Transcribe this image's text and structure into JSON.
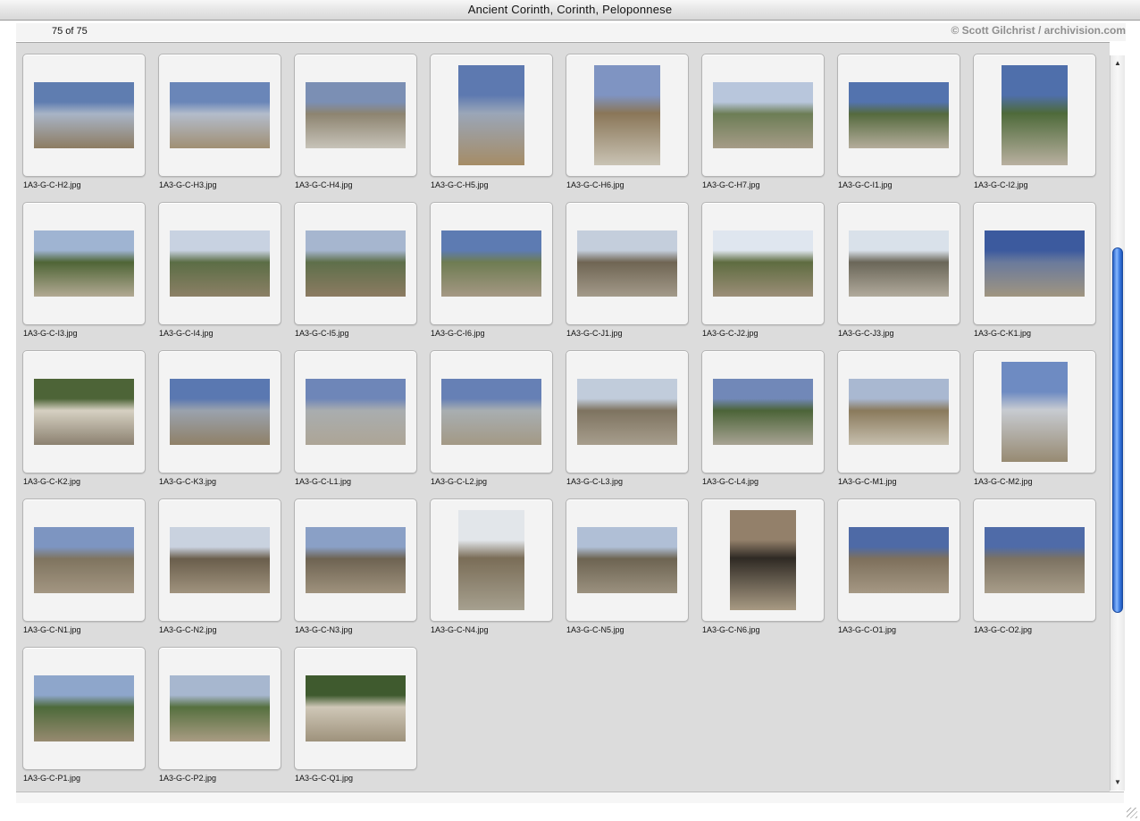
{
  "window": {
    "title": "Ancient Corinth, Corinth, Peloponnese"
  },
  "header": {
    "count": "75 of 75",
    "credit": "© Scott Gilchrist / archivision.com"
  },
  "scroll": {
    "position": 0.52,
    "visible_fraction": 0.52
  },
  "thumbnails": [
    {
      "name": "1A3-G-C-H2.jpg",
      "orientation": "land",
      "colors": [
        "#5f7db0",
        "#a8b4c6",
        "#8d7c62"
      ]
    },
    {
      "name": "1A3-G-C-H3.jpg",
      "orientation": "land",
      "colors": [
        "#6a86b8",
        "#b3bccb",
        "#a08f73"
      ]
    },
    {
      "name": "1A3-G-C-H4.jpg",
      "orientation": "land",
      "colors": [
        "#7b8fb4",
        "#8d8470",
        "#c7c3b9"
      ]
    },
    {
      "name": "1A3-G-C-H5.jpg",
      "orientation": "port",
      "colors": [
        "#5d79b0",
        "#9aa6b8",
        "#a58c66"
      ]
    },
    {
      "name": "1A3-G-C-H6.jpg",
      "orientation": "port",
      "colors": [
        "#7f94c2",
        "#8a7658",
        "#c9c3b4"
      ]
    },
    {
      "name": "1A3-G-C-H7.jpg",
      "orientation": "land",
      "colors": [
        "#b8c6dc",
        "#6c7d55",
        "#a69c88"
      ]
    },
    {
      "name": "1A3-G-C-I1.jpg",
      "orientation": "land",
      "colors": [
        "#5373ae",
        "#556a3e",
        "#b5ad9c"
      ]
    },
    {
      "name": "1A3-G-C-I2.jpg",
      "orientation": "port",
      "colors": [
        "#4f6fab",
        "#4e6a3a",
        "#b9b0a0"
      ]
    },
    {
      "name": "1A3-G-C-I3.jpg",
      "orientation": "land",
      "colors": [
        "#9fb4d2",
        "#4f6536",
        "#b2a993"
      ]
    },
    {
      "name": "1A3-G-C-I4.jpg",
      "orientation": "land",
      "colors": [
        "#c8d2e1",
        "#5b6d45",
        "#8c8066"
      ]
    },
    {
      "name": "1A3-G-C-I5.jpg",
      "orientation": "land",
      "colors": [
        "#a6b6cf",
        "#5e6f4a",
        "#8c7b62"
      ]
    },
    {
      "name": "1A3-G-C-I6.jpg",
      "orientation": "land",
      "colors": [
        "#5d7bb2",
        "#6e7c52",
        "#a59884"
      ]
    },
    {
      "name": "1A3-G-C-J1.jpg",
      "orientation": "land",
      "colors": [
        "#c4cedc",
        "#6f6553",
        "#a39a8a"
      ]
    },
    {
      "name": "1A3-G-C-J2.jpg",
      "orientation": "land",
      "colors": [
        "#dfe6ef",
        "#5e6c40",
        "#9c8e78"
      ]
    },
    {
      "name": "1A3-G-C-J3.jpg",
      "orientation": "land",
      "colors": [
        "#d9e1ea",
        "#6a6658",
        "#b1aa9c"
      ]
    },
    {
      "name": "1A3-G-C-K1.jpg",
      "orientation": "land",
      "colors": [
        "#3c5a9e",
        "#6a7a9c",
        "#a09580"
      ]
    },
    {
      "name": "1A3-G-C-K2.jpg",
      "orientation": "land",
      "colors": [
        "#4d6437",
        "#d6d0c2",
        "#8b8170"
      ]
    },
    {
      "name": "1A3-G-C-K3.jpg",
      "orientation": "land",
      "colors": [
        "#5a78b1",
        "#9aa2ad",
        "#8f8067"
      ]
    },
    {
      "name": "1A3-G-C-L1.jpg",
      "orientation": "land",
      "colors": [
        "#6e86b8",
        "#a9adaf",
        "#ada596"
      ]
    },
    {
      "name": "1A3-G-C-L2.jpg",
      "orientation": "land",
      "colors": [
        "#6680b5",
        "#a8aeb1",
        "#a39985"
      ]
    },
    {
      "name": "1A3-G-C-L3.jpg",
      "orientation": "land",
      "colors": [
        "#c1ccdb",
        "#7e7360",
        "#a79e8d"
      ]
    },
    {
      "name": "1A3-G-C-L4.jpg",
      "orientation": "land",
      "colors": [
        "#7188b8",
        "#4c6438",
        "#a8a394"
      ]
    },
    {
      "name": "1A3-G-C-M1.jpg",
      "orientation": "land",
      "colors": [
        "#a9b8d1",
        "#8a7a5c",
        "#c6bfae"
      ]
    },
    {
      "name": "1A3-G-C-M2.jpg",
      "orientation": "port",
      "colors": [
        "#6e8bc2",
        "#c7cbd1",
        "#978a72"
      ]
    },
    {
      "name": "1A3-G-C-N1.jpg",
      "orientation": "land",
      "colors": [
        "#7d95c1",
        "#7f745f",
        "#a39682"
      ]
    },
    {
      "name": "1A3-G-C-N2.jpg",
      "orientation": "land",
      "colors": [
        "#c9d2df",
        "#6a5e4c",
        "#a0937e"
      ]
    },
    {
      "name": "1A3-G-C-N3.jpg",
      "orientation": "land",
      "colors": [
        "#8aa0c6",
        "#6e6352",
        "#9f927d"
      ]
    },
    {
      "name": "1A3-G-C-N4.jpg",
      "orientation": "port",
      "colors": [
        "#e2e6ea",
        "#7a6d57",
        "#a6a08f"
      ]
    },
    {
      "name": "1A3-G-C-N5.jpg",
      "orientation": "land",
      "colors": [
        "#b0bfd6",
        "#6d6452",
        "#9b917f"
      ]
    },
    {
      "name": "1A3-G-C-N6.jpg",
      "orientation": "port",
      "colors": [
        "#93806a",
        "#2f2a24",
        "#a89a83"
      ]
    },
    {
      "name": "1A3-G-C-O1.jpg",
      "orientation": "land",
      "colors": [
        "#4e6aa6",
        "#7e705c",
        "#a59884"
      ]
    },
    {
      "name": "1A3-G-C-O2.jpg",
      "orientation": "land",
      "colors": [
        "#4f6ba8",
        "#7c7262",
        "#a89d89"
      ]
    },
    {
      "name": "1A3-G-C-P1.jpg",
      "orientation": "land",
      "colors": [
        "#8ea6cb",
        "#4d6a3a",
        "#978a70"
      ]
    },
    {
      "name": "1A3-G-C-P2.jpg",
      "orientation": "land",
      "colors": [
        "#a7b7cf",
        "#56703f",
        "#a99c83"
      ]
    },
    {
      "name": "1A3-G-C-Q1.jpg",
      "orientation": "land",
      "colors": [
        "#3f5a2e",
        "#cfc7b7",
        "#9e927c"
      ]
    }
  ]
}
